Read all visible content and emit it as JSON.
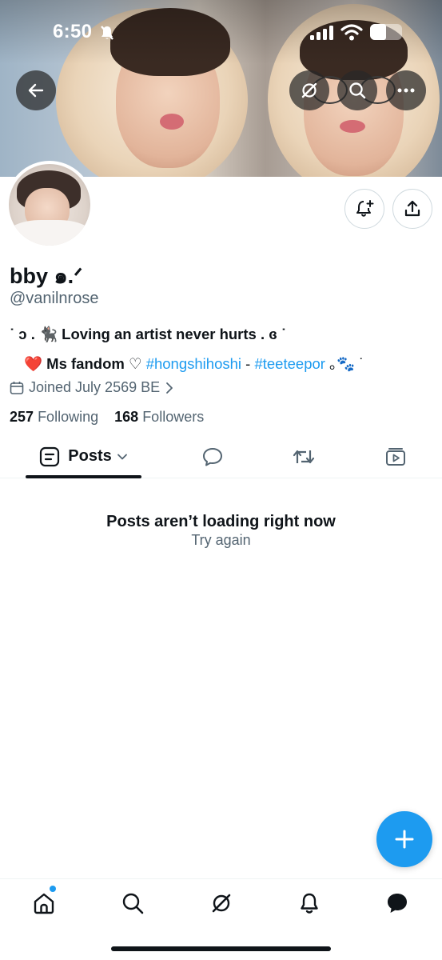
{
  "status_bar": {
    "time": "6:50"
  },
  "profile": {
    "display_name": "bby ๑.ᐟ",
    "handle": "@vanilnrose",
    "bio_line1": "˙ ɔ . 🐈‍⬛ Loving an artist never hurts . ɞ ˙",
    "bio_line2_prefix": "❤️ Ms fandom ♡ ",
    "bio_link1": "#hongshihoshi",
    "bio_separator": " - ",
    "bio_link2": "#teeteepor",
    "bio_line2_suffix": " ｡🐾 ˙",
    "joined": "Joined July 2569 BE",
    "following_count": "257",
    "following_label": "Following",
    "followers_count": "168",
    "followers_label": "Followers"
  },
  "tabs": {
    "posts_label": "Posts"
  },
  "empty_state": {
    "title": "Posts aren’t loading right now",
    "retry": "Try again"
  },
  "colors": {
    "accent": "#1d9bf0",
    "text_primary": "#0f1419",
    "text_secondary": "#536471",
    "heart": "#e0245e"
  },
  "icons": {
    "back": "arrow-left-icon",
    "grok": "grok-icon",
    "search": "search-icon",
    "more": "more-icon",
    "notify": "bell-plus-icon",
    "share": "share-icon",
    "calendar": "calendar-icon",
    "replies": "speech-bubble-icon",
    "reposts": "repost-icon",
    "media": "media-icon",
    "compose": "plus-icon",
    "home": "home-icon",
    "explore": "search-icon",
    "notifications": "bell-icon",
    "messages": "chat-icon"
  }
}
